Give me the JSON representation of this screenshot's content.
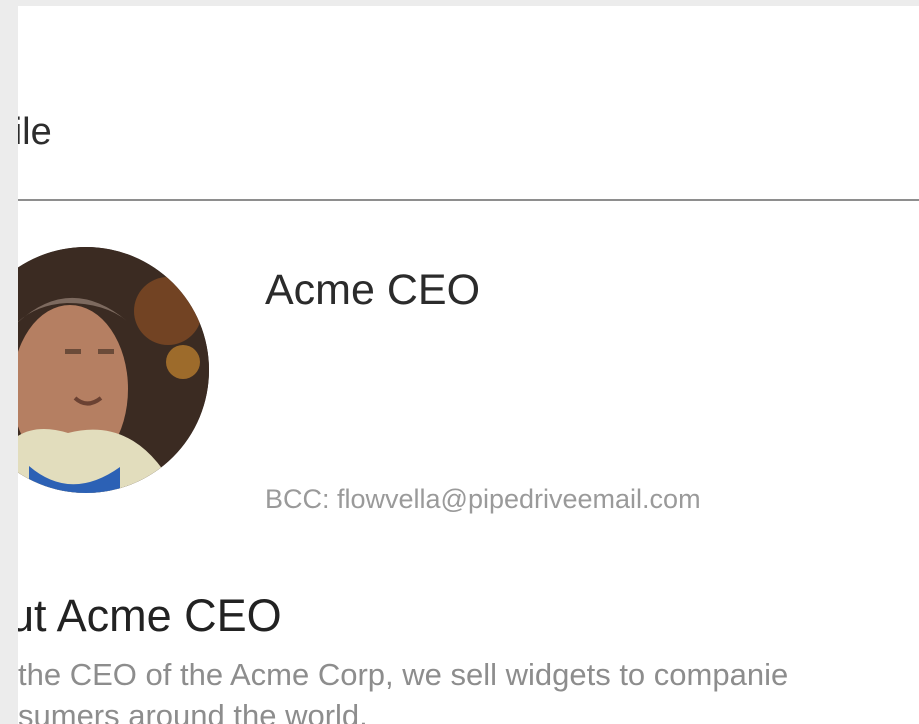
{
  "header": {
    "title": "ofile"
  },
  "profile": {
    "name": "Acme CEO",
    "bcc": "BCC: flowvella@pipedriveemail.com"
  },
  "about": {
    "heading": "out Acme CEO",
    "lines": [
      "the CEO of the Acme Corp, we sell widgets to companie",
      "sumers around the world."
    ]
  }
}
